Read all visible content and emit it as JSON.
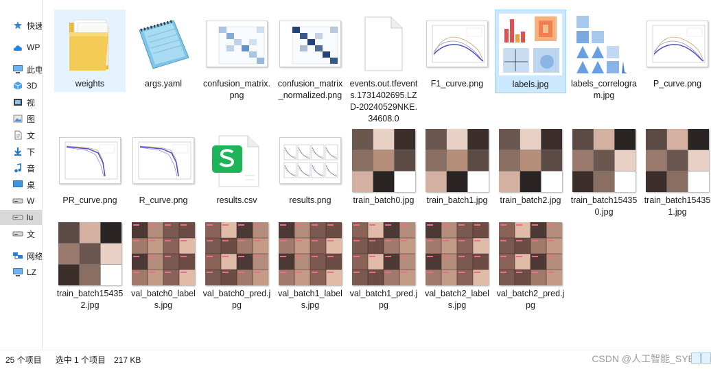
{
  "nav": {
    "items": [
      {
        "label": "快速",
        "icon": "star-icon"
      },
      {
        "label": "WP",
        "icon": "cloud-icon"
      },
      {
        "label": "此电",
        "icon": "computer-icon"
      },
      {
        "label": "3D",
        "icon": "cube-icon"
      },
      {
        "label": "视",
        "icon": "video-icon"
      },
      {
        "label": "图",
        "icon": "picture-icon"
      },
      {
        "label": "文",
        "icon": "document-icon"
      },
      {
        "label": "下",
        "icon": "download-icon"
      },
      {
        "label": "音",
        "icon": "music-icon"
      },
      {
        "label": "桌",
        "icon": "desktop-icon"
      },
      {
        "label": "W",
        "icon": "drive-icon"
      },
      {
        "label": "lu",
        "icon": "drive-icon"
      },
      {
        "label": "文",
        "icon": "drive-icon"
      },
      {
        "label": "网络",
        "icon": "network-icon"
      },
      {
        "label": "LZ",
        "icon": "computer-icon"
      }
    ],
    "active_index": 11
  },
  "files": [
    {
      "name": "weights",
      "kind": "folder",
      "state": "hover"
    },
    {
      "name": "args.yaml",
      "kind": "yaml"
    },
    {
      "name": "confusion_matrix.png",
      "kind": "matrix",
      "accent": "#3a78b8"
    },
    {
      "name": "confusion_matrix_normalized.png",
      "kind": "matrix",
      "accent": "#08306b"
    },
    {
      "name": "events.out.tfevents.1731402695.LZD-20240529NKE.34608.0",
      "kind": "blank"
    },
    {
      "name": "F1_curve.png",
      "kind": "curve"
    },
    {
      "name": "labels.jpg",
      "kind": "labels",
      "state": "selected"
    },
    {
      "name": "labels_correlogram.jpg",
      "kind": "correlogram"
    },
    {
      "name": "P_curve.png",
      "kind": "curve"
    },
    {
      "name": "PR_curve.png",
      "kind": "prcurve"
    },
    {
      "name": "R_curve.png",
      "kind": "prcurve"
    },
    {
      "name": "results.csv",
      "kind": "csv"
    },
    {
      "name": "results.png",
      "kind": "results"
    },
    {
      "name": "train_batch0.jpg",
      "kind": "photo",
      "tone": "#5a4a44"
    },
    {
      "name": "train_batch1.jpg",
      "kind": "photo",
      "tone": "#6b4f45"
    },
    {
      "name": "train_batch2.jpg",
      "kind": "photo",
      "tone": "#7a625a"
    },
    {
      "name": "train_batch154350.jpg",
      "kind": "photo",
      "tone": "#5e4640"
    },
    {
      "name": "train_batch154351.jpg",
      "kind": "photo",
      "tone": "#6e5a58"
    },
    {
      "name": "train_batch154352.jpg",
      "kind": "photo",
      "tone": "#4f4a4a"
    },
    {
      "name": "val_batch0_labels.jpg",
      "kind": "valphoto",
      "tone": "#8a6660"
    },
    {
      "name": "val_batch0_pred.jpg",
      "kind": "valphoto",
      "tone": "#8a6660"
    },
    {
      "name": "val_batch1_labels.jpg",
      "kind": "valphoto",
      "tone": "#8f6b60"
    },
    {
      "name": "val_batch1_pred.jpg",
      "kind": "valphoto",
      "tone": "#8f6b60"
    },
    {
      "name": "val_batch2_labels.jpg",
      "kind": "valphoto",
      "tone": "#86645c"
    },
    {
      "name": "val_batch2_pred.jpg",
      "kind": "valphoto",
      "tone": "#86645c"
    }
  ],
  "status": {
    "count": "25 个项目",
    "selection": "选中 1 个项目",
    "size": "217 KB"
  },
  "watermark": "CSDN @人工智能_SYBH",
  "colors": {
    "selected_bg": "#cce8ff",
    "hover_bg": "#e5f3ff",
    "folder": "#f5c84c"
  }
}
